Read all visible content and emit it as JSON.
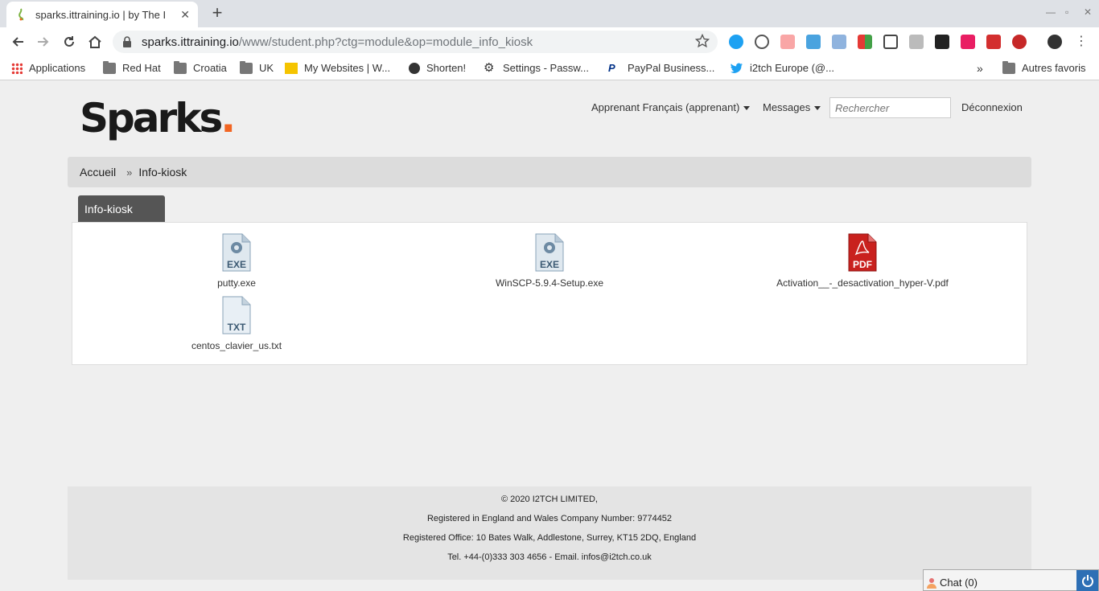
{
  "browser": {
    "tab_title": "sparks.ittraining.io | by The I",
    "tab_close": "✕",
    "new_tab": "+",
    "url_host": "sparks.ittraining.io",
    "url_path": "/www/student.php?ctg=module&op=module_info_kiosk",
    "bookmarks": [
      "Applications",
      "Red Hat",
      "Croatia",
      "UK",
      "My Websites | W...",
      "Shorten!",
      "Settings - Passw...",
      "PayPal Business...",
      "i2tch Europe (@...",
      "Autres favoris"
    ],
    "more_bookmarks": "»"
  },
  "header": {
    "logo_text": "Sparks",
    "logo_dot": ".",
    "user_menu": "Apprenant Français (apprenant)",
    "messages_menu": "Messages",
    "search_placeholder": "Rechercher",
    "logout": "Déconnexion"
  },
  "breadcrumb": {
    "home": "Accueil",
    "separator": "»",
    "current": "Info-kiosk"
  },
  "panel": {
    "tab_label": "Info-kiosk",
    "files": [
      {
        "name": "putty.exe",
        "type": "EXE"
      },
      {
        "name": "WinSCP-5.9.4-Setup.exe",
        "type": "EXE"
      },
      {
        "name": "Activation__-_desactivation_hyper-V.pdf",
        "type": "PDF"
      },
      {
        "name": "centos_clavier_us.txt",
        "type": "TXT"
      }
    ]
  },
  "footer": {
    "line1": "© 2020 I2TCH LIMITED,",
    "line2": "Registered in England and Wales Company Number: 9774452",
    "line3": "Registered Office: 10 Bates Walk, Addlestone, Surrey, KT15 2DQ, England",
    "line4": "Tel. +44-(0)333 303 4656 - Email. infos@i2tch.co.uk"
  },
  "chat": {
    "label": "Chat (0)"
  },
  "colors": {
    "accent": "#f26522",
    "pdf_red": "#c9211e",
    "exe_blue": "#9ab3c9",
    "chat_blue": "#2d6fb5"
  }
}
